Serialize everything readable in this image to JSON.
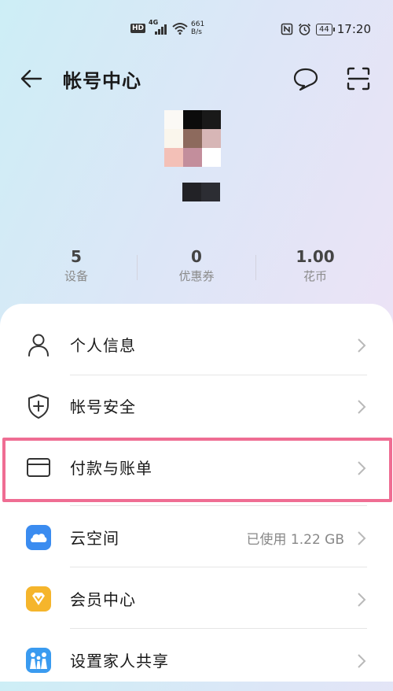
{
  "status_bar": {
    "hd": "HD",
    "network": "4G",
    "speed_value": "661",
    "speed_unit": "B/s",
    "battery": "44",
    "time": "17:20",
    "icons": [
      "nfc-icon",
      "alarm-icon",
      "battery-icon",
      "wifi-icon",
      "signal-icon"
    ]
  },
  "header": {
    "title": "帐号中心",
    "icons": [
      "back-arrow-icon",
      "message-bubble-icon",
      "scan-icon"
    ]
  },
  "profile": {
    "avatar_pixels": [
      "#fbf9f5",
      "#0b0b0b",
      "#191919",
      "#faf6ec",
      "#8d6a5d",
      "#d7b6b6",
      "#f3c0b7",
      "#c38e9c",
      "#ffffff"
    ],
    "nickname_pixels": [
      "#222226",
      "#2c2d33"
    ]
  },
  "stats": [
    {
      "value": "5",
      "label": "设备"
    },
    {
      "value": "0",
      "label": "优惠券"
    },
    {
      "value": "1.00",
      "label": "花币"
    }
  ],
  "menu": [
    {
      "label": "个人信息",
      "icon": "person-icon",
      "value": ""
    },
    {
      "label": "帐号安全",
      "icon": "shield-icon",
      "value": ""
    },
    {
      "label": "付款与账单",
      "icon": "card-icon",
      "value": "",
      "highlighted": true
    },
    {
      "label": "云空间",
      "icon": "cloud-icon",
      "value": "已使用 1.22 GB"
    },
    {
      "label": "会员中心",
      "icon": "member-diamond-icon",
      "value": ""
    },
    {
      "label": "设置家人共享",
      "icon": "family-share-icon",
      "value": ""
    }
  ],
  "colors": {
    "highlight": "#ef6d93",
    "cloud": "#3b8cf0",
    "member": "#f5b52c",
    "family": "#3a9bf0"
  }
}
